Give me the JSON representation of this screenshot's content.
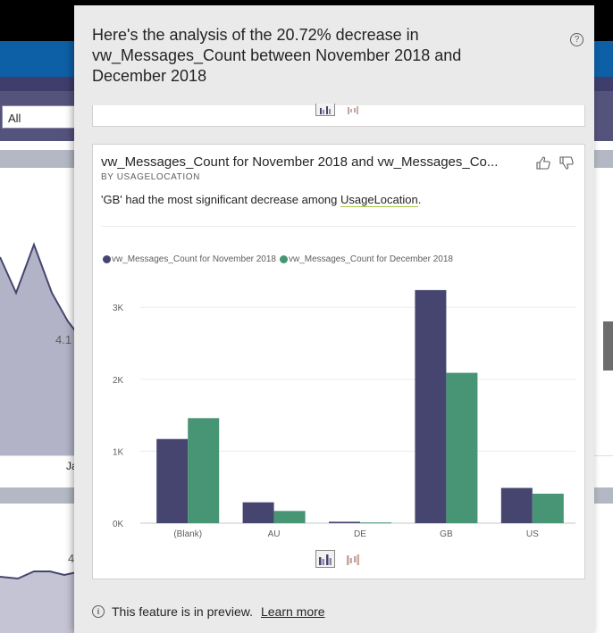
{
  "background": {
    "filter_value": "All",
    "label_a": "4.1",
    "label_b": "Ja",
    "label_c": "4"
  },
  "panel": {
    "title": "Here's the analysis of the 20.72% decrease in vw_Messages_Count between November 2018 and December 2018",
    "help_icon": "question-circle-icon"
  },
  "card": {
    "title": "vw_Messages_Count for November 2018 and vw_Messages_Co...",
    "subtitle": "BY USAGELOCATION",
    "explanation_prefix": "'GB' had the most significant decrease among ",
    "explanation_field": "UsageLocation",
    "explanation_suffix": "."
  },
  "chart_data": {
    "type": "bar",
    "categories": [
      "(Blank)",
      "AU",
      "DE",
      "GB",
      "US"
    ],
    "series": [
      {
        "name": "vw_Messages_Count for November 2018",
        "color": "#46456f",
        "values": [
          1170,
          290,
          20,
          3240,
          490
        ]
      },
      {
        "name": "vw_Messages_Count for December 2018",
        "color": "#479574",
        "values": [
          1460,
          170,
          10,
          2090,
          410
        ]
      }
    ],
    "yticks": [
      "0K",
      "1K",
      "2K",
      "3K"
    ],
    "ytick_values": [
      0,
      1000,
      2000,
      3000
    ],
    "ylim": [
      0,
      3400
    ],
    "grid": true,
    "legend": "top-left"
  },
  "footer": {
    "notice": "This feature is in preview.",
    "link": "Learn more"
  }
}
